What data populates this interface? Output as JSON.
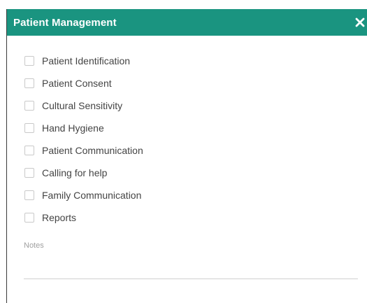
{
  "dialog": {
    "title": "Patient Management",
    "close_icon": "close-icon",
    "accent_color": "#1a9480"
  },
  "checklist": {
    "items": [
      {
        "label": "Patient Identification",
        "checked": false
      },
      {
        "label": "Patient Consent",
        "checked": false
      },
      {
        "label": "Cultural Sensitivity",
        "checked": false
      },
      {
        "label": "Hand Hygiene",
        "checked": false
      },
      {
        "label": "Patient Communication",
        "checked": false
      },
      {
        "label": "Calling for help",
        "checked": false
      },
      {
        "label": "Family Communication",
        "checked": false
      },
      {
        "label": "Reports",
        "checked": false
      }
    ]
  },
  "notes": {
    "label": "Notes",
    "value": ""
  }
}
